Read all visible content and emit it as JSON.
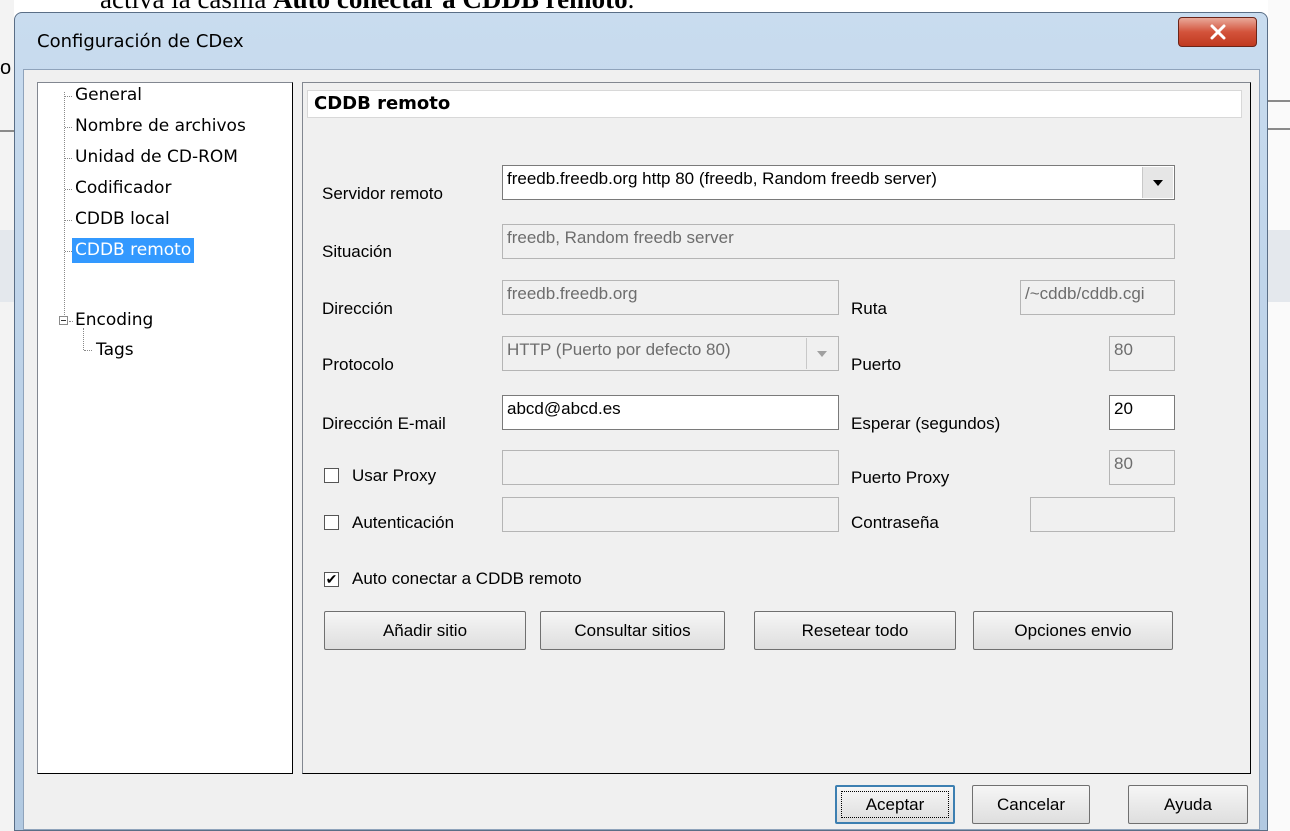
{
  "background_doc": {
    "text_prefix": "activa la casilla ",
    "text_bold": "Auto conectar a  CDDB remoto",
    "text_suffix": ".",
    "left_char": "o"
  },
  "window": {
    "title": "Configuración de CDex",
    "close_label": "X"
  },
  "tree": {
    "items": [
      {
        "label": "General"
      },
      {
        "label": "Nombre de archivos"
      },
      {
        "label": "Unidad de CD-ROM"
      },
      {
        "label": "Codificador"
      },
      {
        "label": "CDDB local"
      },
      {
        "label": "CDDB remoto",
        "selected": true
      },
      {
        "label": "Encoding",
        "expanded": true
      },
      {
        "label": "Tags"
      }
    ]
  },
  "panel": {
    "title": "CDDB remoto",
    "servidor_label": "Servidor remoto",
    "servidor_value": "freedb.freedb.org http  80  (freedb, Random freedb server)",
    "situacion_label": "Situación",
    "situacion_value": "freedb, Random freedb server",
    "direccion_label": "Dirección",
    "direccion_value": "freedb.freedb.org",
    "ruta_label": "Ruta",
    "ruta_value": "/~cddb/cddb.cgi",
    "protocolo_label": "Protocolo",
    "protocolo_value": "HTTP (Puerto por defecto 80)",
    "puerto_label": "Puerto",
    "puerto_value": "80",
    "email_label": "Dirección E-mail",
    "email_value": "abcd@abcd.es",
    "esperar_label": "Esperar (segundos)",
    "esperar_value": "20",
    "usar_proxy_label": "Usar Proxy",
    "usar_proxy_checked": false,
    "proxy_value": "",
    "puerto_proxy_label": "Puerto Proxy",
    "puerto_proxy_value": "80",
    "autenticacion_label": "Autenticación",
    "autenticacion_checked": false,
    "auth_value": "",
    "contrasena_label": "Contraseña",
    "contrasena_value": "",
    "auto_conectar_label": "Auto conectar a CDDB remoto",
    "auto_conectar_checked": true,
    "check_mark": "✔",
    "buttons": {
      "anadir": "Añadir sitio",
      "consultar": "Consultar sitios",
      "resetear": "Resetear todo",
      "opciones": "Opciones envio"
    }
  },
  "footer": {
    "aceptar": "Aceptar",
    "cancelar": "Cancelar",
    "ayuda": "Ayuda"
  },
  "colors": {
    "selection": "#3399ff",
    "close_button": "#c9432a",
    "title_bar": "#c2d6ec"
  }
}
